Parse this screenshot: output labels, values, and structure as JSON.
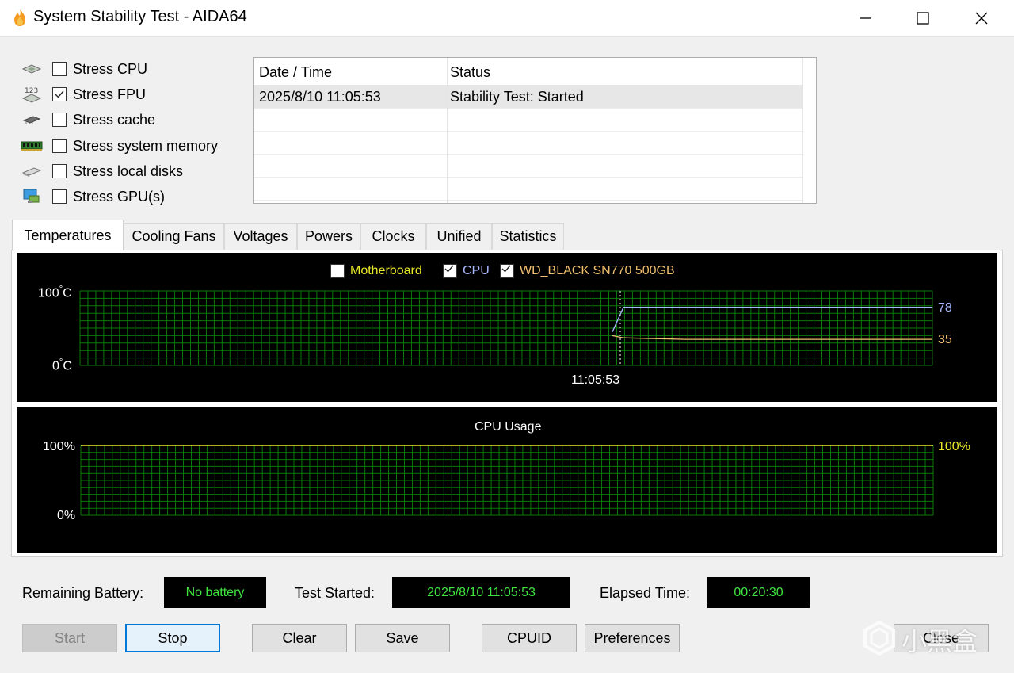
{
  "window": {
    "title": "System Stability Test - AIDA64"
  },
  "stress_options": [
    {
      "label": "Stress CPU",
      "checked": false,
      "icon": "cpu-chip-icon"
    },
    {
      "label": "Stress FPU",
      "checked": true,
      "icon": "fpu-123-icon"
    },
    {
      "label": "Stress cache",
      "checked": false,
      "icon": "cache-chip-icon"
    },
    {
      "label": "Stress system memory",
      "checked": false,
      "icon": "memory-module-icon"
    },
    {
      "label": "Stress local disks",
      "checked": false,
      "icon": "disk-drive-icon"
    },
    {
      "label": "Stress GPU(s)",
      "checked": false,
      "icon": "gpu-monitor-icon"
    }
  ],
  "log": {
    "columns": [
      "Date / Time",
      "Status"
    ],
    "rows": [
      {
        "datetime": "2025/8/10 11:05:53",
        "status": "Stability Test: Started"
      }
    ]
  },
  "tabs": [
    "Temperatures",
    "Cooling Fans",
    "Voltages",
    "Powers",
    "Clocks",
    "Unified",
    "Statistics"
  ],
  "active_tab": "Temperatures",
  "temperature_graph": {
    "legend": [
      {
        "label": "Motherboard",
        "checked": false,
        "color": "#e8e82a"
      },
      {
        "label": "CPU",
        "checked": true,
        "color": "#a9b7ff"
      },
      {
        "label": "WD_BLACK SN770 500GB",
        "checked": true,
        "color": "#f0c070"
      }
    ],
    "y_max_label": "100",
    "y_min_label": "0",
    "unit": "°C",
    "time_label": "11:05:53",
    "cpu_current": "78",
    "ssd_current": "35"
  },
  "cpu_usage_graph": {
    "title": "CPU Usage",
    "y_max_label": "100%",
    "y_min_label": "0%",
    "current": "100%",
    "current_color": "#e8e82a"
  },
  "chart_data": [
    {
      "type": "line",
      "title": "",
      "ylim": [
        0,
        100
      ],
      "series": [
        {
          "name": "CPU",
          "values": [
            45,
            78,
            78,
            78,
            78,
            78,
            78
          ]
        },
        {
          "name": "WD_BLACK SN770 500GB",
          "values": [
            40,
            37,
            35,
            35,
            35,
            35,
            35
          ]
        }
      ]
    },
    {
      "type": "line",
      "title": "CPU Usage",
      "ylim": [
        0,
        100
      ],
      "series": [
        {
          "name": "CPU Usage",
          "values": [
            100
          ]
        }
      ]
    }
  ],
  "status": {
    "battery_label": "Remaining Battery:",
    "battery_value": "No battery",
    "started_label": "Test Started:",
    "started_value": "2025/8/10 11:05:53",
    "elapsed_label": "Elapsed Time:",
    "elapsed_value": "00:20:30"
  },
  "buttons": {
    "start": "Start",
    "stop": "Stop",
    "clear": "Clear",
    "save": "Save",
    "cpuid": "CPUID",
    "preferences": "Preferences",
    "close": "Close"
  },
  "watermark": {
    "text": "小黑盒"
  }
}
